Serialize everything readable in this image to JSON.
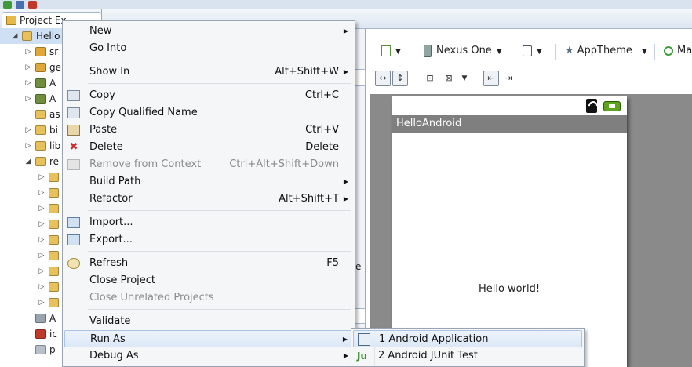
{
  "explorer": {
    "tab_label": "Project Ex",
    "rows": [
      {
        "label": "Hello",
        "twisty": "◢",
        "icon": "android-project-icon",
        "color": "#e8c15a",
        "selected": true,
        "indent": 0
      },
      {
        "label": "sr",
        "twisty": "▷",
        "icon": "package-folder-icon",
        "color": "#e0a838",
        "indent": 1
      },
      {
        "label": "ge",
        "twisty": "▷",
        "icon": "package-folder-icon",
        "color": "#e0a838",
        "indent": 1
      },
      {
        "label": "A",
        "twisty": "▷",
        "icon": "library-icon",
        "color": "#6f8f3a",
        "indent": 1
      },
      {
        "label": "A",
        "twisty": "▷",
        "icon": "library-icon",
        "color": "#6f8f3a",
        "indent": 1
      },
      {
        "label": "as",
        "twisty": "",
        "icon": "folder-icon",
        "color": "#e8c15a",
        "indent": 1
      },
      {
        "label": "bi",
        "twisty": "▷",
        "icon": "folder-icon",
        "color": "#e8c15a",
        "indent": 1
      },
      {
        "label": "lib",
        "twisty": "▷",
        "icon": "folder-icon",
        "color": "#e8c15a",
        "indent": 1
      },
      {
        "label": "re",
        "twisty": "◢",
        "icon": "folder-icon",
        "color": "#e8c15a",
        "indent": 1
      },
      {
        "label": "",
        "twisty": "▷",
        "icon": "folder-icon",
        "color": "#e8c15a",
        "indent": 2
      },
      {
        "label": "",
        "twisty": "▷",
        "icon": "folder-icon",
        "color": "#e8c15a",
        "indent": 2
      },
      {
        "label": "",
        "twisty": "▷",
        "icon": "folder-icon",
        "color": "#e8c15a",
        "indent": 2
      },
      {
        "label": "",
        "twisty": "▷",
        "icon": "folder-icon",
        "color": "#e8c15a",
        "indent": 2
      },
      {
        "label": "",
        "twisty": "▷",
        "icon": "folder-icon",
        "color": "#e8c15a",
        "indent": 2
      },
      {
        "label": "",
        "twisty": "▷",
        "icon": "folder-icon",
        "color": "#e8c15a",
        "indent": 2
      },
      {
        "label": "",
        "twisty": "▷",
        "icon": "folder-icon",
        "color": "#e8c15a",
        "indent": 2
      },
      {
        "label": "",
        "twisty": "▷",
        "icon": "folder-icon",
        "color": "#e8c15a",
        "indent": 2
      },
      {
        "label": "",
        "twisty": "▷",
        "icon": "folder-icon",
        "color": "#e8c15a",
        "indent": 2
      },
      {
        "label": "A",
        "twisty": "",
        "icon": "manifest-file-icon",
        "color": "#9aa4b1",
        "indent": 1
      },
      {
        "label": "ic",
        "twisty": "",
        "icon": "image-file-icon",
        "color": "#c0392b",
        "indent": 1
      },
      {
        "label": "p",
        "twisty": "",
        "icon": "text-file-icon",
        "color": "#b8bfc8",
        "indent": 1
      }
    ]
  },
  "palette": {
    "partial_letter": "e"
  },
  "editor": {
    "config": {
      "device": "Nexus One",
      "theme": "AppTheme",
      "more": "Ma"
    },
    "preview": {
      "app_title": "HelloAndroid",
      "body_text": "Hello world!"
    }
  },
  "context_menu": {
    "groups": [
      [
        {
          "label": "New",
          "shortcut": "",
          "submenu": true,
          "icon": ""
        },
        {
          "label": "Go Into",
          "shortcut": "",
          "submenu": false,
          "icon": ""
        }
      ],
      [
        {
          "label": "Show In",
          "shortcut": "Alt+Shift+W",
          "submenu": true,
          "icon": ""
        }
      ],
      [
        {
          "label": "Copy",
          "shortcut": "Ctrl+C",
          "submenu": false,
          "icon": "copy-icon"
        },
        {
          "label": "Copy Qualified Name",
          "shortcut": "",
          "submenu": false,
          "icon": "copy-qualified-name-icon"
        },
        {
          "label": "Paste",
          "shortcut": "Ctrl+V",
          "submenu": false,
          "icon": "paste-icon"
        },
        {
          "label": "Delete",
          "shortcut": "Delete",
          "submenu": false,
          "icon": "delete-icon"
        },
        {
          "label": "Remove from Context",
          "shortcut": "Ctrl+Alt+Shift+Down",
          "submenu": false,
          "icon": "remove-from-context-icon",
          "disabled": true
        },
        {
          "label": "Build Path",
          "shortcut": "",
          "submenu": true,
          "icon": ""
        },
        {
          "label": "Refactor",
          "shortcut": "Alt+Shift+T",
          "submenu": true,
          "icon": ""
        }
      ],
      [
        {
          "label": "Import...",
          "shortcut": "",
          "submenu": false,
          "icon": "import-icon"
        },
        {
          "label": "Export...",
          "shortcut": "",
          "submenu": false,
          "icon": "export-icon"
        }
      ],
      [
        {
          "label": "Refresh",
          "shortcut": "F5",
          "submenu": false,
          "icon": "refresh-icon"
        },
        {
          "label": "Close Project",
          "shortcut": "",
          "submenu": false,
          "icon": ""
        },
        {
          "label": "Close Unrelated Projects",
          "shortcut": "",
          "submenu": false,
          "icon": "",
          "disabled": true
        }
      ],
      [
        {
          "label": "Validate",
          "shortcut": "",
          "submenu": false,
          "icon": ""
        },
        {
          "label": "Run As",
          "shortcut": "",
          "submenu": true,
          "icon": "",
          "highlighted": true
        },
        {
          "label": "Debug As",
          "shortcut": "",
          "submenu": true,
          "icon": ""
        }
      ]
    ]
  },
  "run_as_submenu": [
    {
      "label": "1 Android Application",
      "icon": "android-application-icon",
      "highlighted": true
    },
    {
      "label": "2 Android JUnit Test",
      "icon": "junit-test-icon"
    }
  ],
  "colors": {
    "selection": "#cfe0f5",
    "menu_background": "#f5f6f7",
    "action_bar": "#7f7f7f",
    "canvas": "#8a8a8a",
    "battery": "#5da51e"
  }
}
